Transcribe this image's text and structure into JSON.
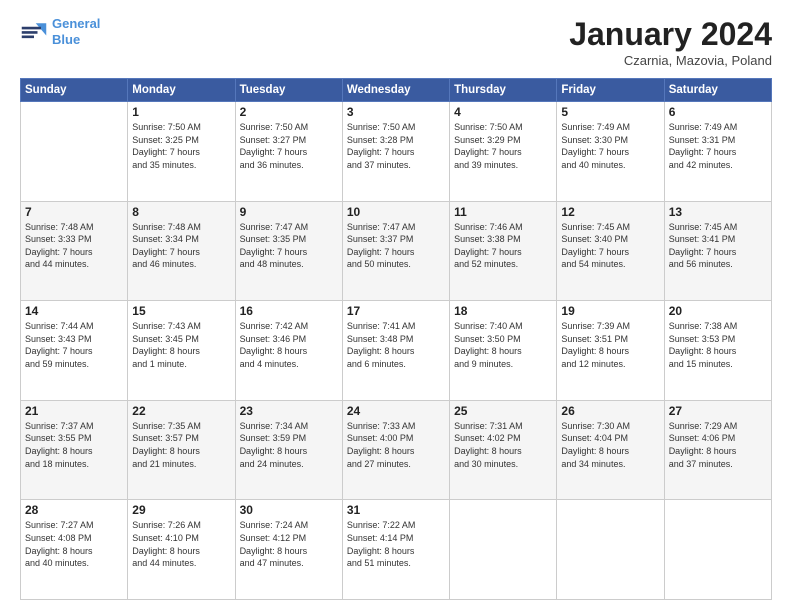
{
  "logo": {
    "line1": "General",
    "line2": "Blue"
  },
  "title": "January 2024",
  "subtitle": "Czarnia, Mazovia, Poland",
  "days_header": [
    "Sunday",
    "Monday",
    "Tuesday",
    "Wednesday",
    "Thursday",
    "Friday",
    "Saturday"
  ],
  "weeks": [
    [
      {
        "num": "",
        "detail": ""
      },
      {
        "num": "1",
        "detail": "Sunrise: 7:50 AM\nSunset: 3:25 PM\nDaylight: 7 hours\nand 35 minutes."
      },
      {
        "num": "2",
        "detail": "Sunrise: 7:50 AM\nSunset: 3:27 PM\nDaylight: 7 hours\nand 36 minutes."
      },
      {
        "num": "3",
        "detail": "Sunrise: 7:50 AM\nSunset: 3:28 PM\nDaylight: 7 hours\nand 37 minutes."
      },
      {
        "num": "4",
        "detail": "Sunrise: 7:50 AM\nSunset: 3:29 PM\nDaylight: 7 hours\nand 39 minutes."
      },
      {
        "num": "5",
        "detail": "Sunrise: 7:49 AM\nSunset: 3:30 PM\nDaylight: 7 hours\nand 40 minutes."
      },
      {
        "num": "6",
        "detail": "Sunrise: 7:49 AM\nSunset: 3:31 PM\nDaylight: 7 hours\nand 42 minutes."
      }
    ],
    [
      {
        "num": "7",
        "detail": "Sunrise: 7:48 AM\nSunset: 3:33 PM\nDaylight: 7 hours\nand 44 minutes."
      },
      {
        "num": "8",
        "detail": "Sunrise: 7:48 AM\nSunset: 3:34 PM\nDaylight: 7 hours\nand 46 minutes."
      },
      {
        "num": "9",
        "detail": "Sunrise: 7:47 AM\nSunset: 3:35 PM\nDaylight: 7 hours\nand 48 minutes."
      },
      {
        "num": "10",
        "detail": "Sunrise: 7:47 AM\nSunset: 3:37 PM\nDaylight: 7 hours\nand 50 minutes."
      },
      {
        "num": "11",
        "detail": "Sunrise: 7:46 AM\nSunset: 3:38 PM\nDaylight: 7 hours\nand 52 minutes."
      },
      {
        "num": "12",
        "detail": "Sunrise: 7:45 AM\nSunset: 3:40 PM\nDaylight: 7 hours\nand 54 minutes."
      },
      {
        "num": "13",
        "detail": "Sunrise: 7:45 AM\nSunset: 3:41 PM\nDaylight: 7 hours\nand 56 minutes."
      }
    ],
    [
      {
        "num": "14",
        "detail": "Sunrise: 7:44 AM\nSunset: 3:43 PM\nDaylight: 7 hours\nand 59 minutes."
      },
      {
        "num": "15",
        "detail": "Sunrise: 7:43 AM\nSunset: 3:45 PM\nDaylight: 8 hours\nand 1 minute."
      },
      {
        "num": "16",
        "detail": "Sunrise: 7:42 AM\nSunset: 3:46 PM\nDaylight: 8 hours\nand 4 minutes."
      },
      {
        "num": "17",
        "detail": "Sunrise: 7:41 AM\nSunset: 3:48 PM\nDaylight: 8 hours\nand 6 minutes."
      },
      {
        "num": "18",
        "detail": "Sunrise: 7:40 AM\nSunset: 3:50 PM\nDaylight: 8 hours\nand 9 minutes."
      },
      {
        "num": "19",
        "detail": "Sunrise: 7:39 AM\nSunset: 3:51 PM\nDaylight: 8 hours\nand 12 minutes."
      },
      {
        "num": "20",
        "detail": "Sunrise: 7:38 AM\nSunset: 3:53 PM\nDaylight: 8 hours\nand 15 minutes."
      }
    ],
    [
      {
        "num": "21",
        "detail": "Sunrise: 7:37 AM\nSunset: 3:55 PM\nDaylight: 8 hours\nand 18 minutes."
      },
      {
        "num": "22",
        "detail": "Sunrise: 7:35 AM\nSunset: 3:57 PM\nDaylight: 8 hours\nand 21 minutes."
      },
      {
        "num": "23",
        "detail": "Sunrise: 7:34 AM\nSunset: 3:59 PM\nDaylight: 8 hours\nand 24 minutes."
      },
      {
        "num": "24",
        "detail": "Sunrise: 7:33 AM\nSunset: 4:00 PM\nDaylight: 8 hours\nand 27 minutes."
      },
      {
        "num": "25",
        "detail": "Sunrise: 7:31 AM\nSunset: 4:02 PM\nDaylight: 8 hours\nand 30 minutes."
      },
      {
        "num": "26",
        "detail": "Sunrise: 7:30 AM\nSunset: 4:04 PM\nDaylight: 8 hours\nand 34 minutes."
      },
      {
        "num": "27",
        "detail": "Sunrise: 7:29 AM\nSunset: 4:06 PM\nDaylight: 8 hours\nand 37 minutes."
      }
    ],
    [
      {
        "num": "28",
        "detail": "Sunrise: 7:27 AM\nSunset: 4:08 PM\nDaylight: 8 hours\nand 40 minutes."
      },
      {
        "num": "29",
        "detail": "Sunrise: 7:26 AM\nSunset: 4:10 PM\nDaylight: 8 hours\nand 44 minutes."
      },
      {
        "num": "30",
        "detail": "Sunrise: 7:24 AM\nSunset: 4:12 PM\nDaylight: 8 hours\nand 47 minutes."
      },
      {
        "num": "31",
        "detail": "Sunrise: 7:22 AM\nSunset: 4:14 PM\nDaylight: 8 hours\nand 51 minutes."
      },
      {
        "num": "",
        "detail": ""
      },
      {
        "num": "",
        "detail": ""
      },
      {
        "num": "",
        "detail": ""
      }
    ]
  ]
}
